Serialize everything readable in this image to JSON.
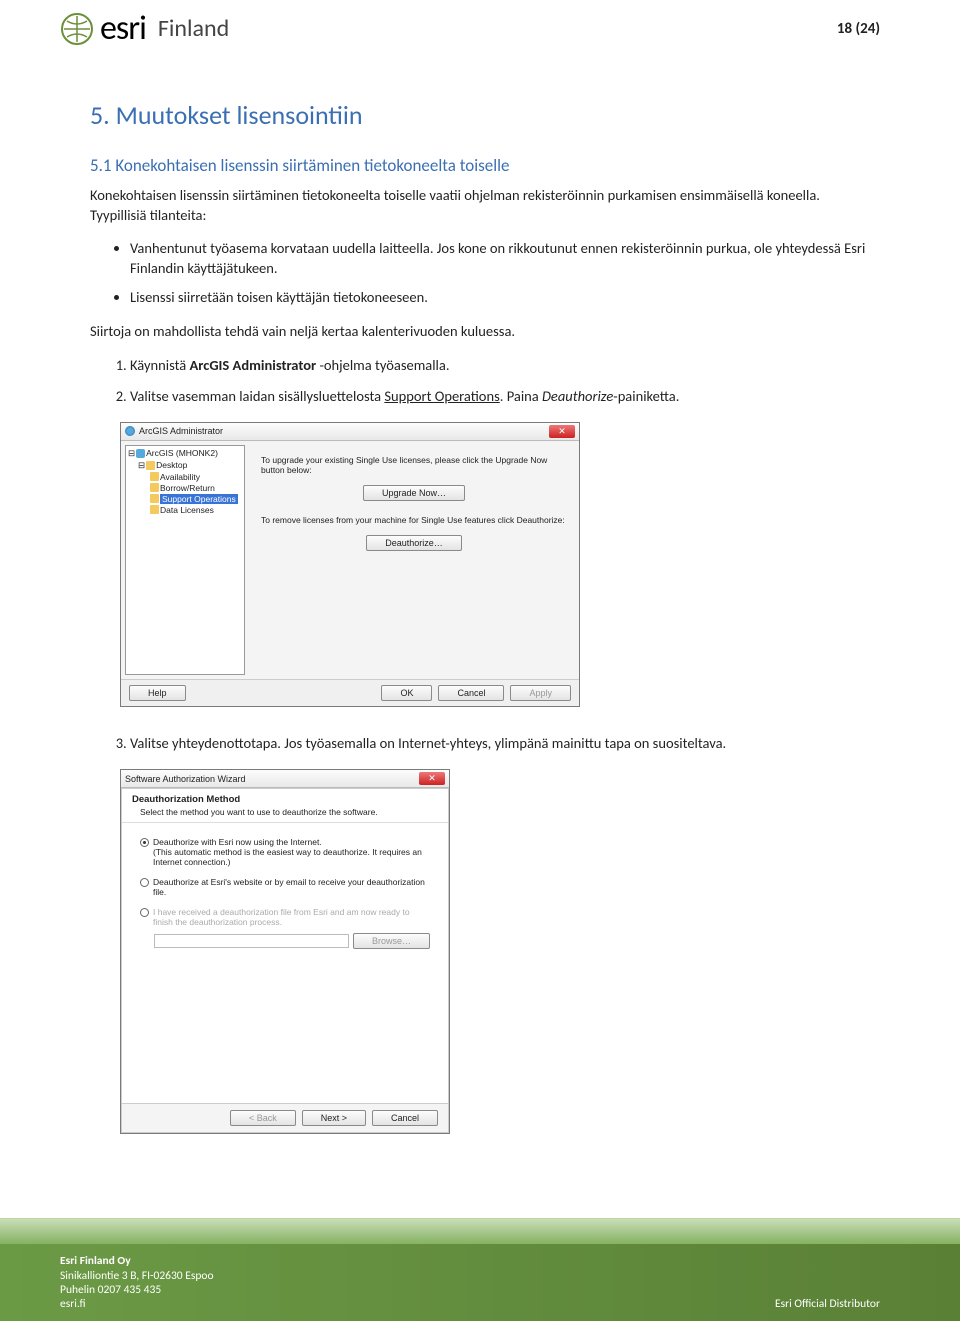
{
  "header": {
    "brand": "esri",
    "country": "Finland",
    "pagenum": "18 (24)"
  },
  "h1": "5. Muutokset lisensointiin",
  "h2": "5.1 Konekohtaisen lisenssin siirtäminen tietokoneelta toiselle",
  "intro": "Konekohtaisen lisenssin siirtäminen tietokoneelta toiselle vaatii ohjelman rekisteröinnin purkamisen ensimmäisellä koneella. Tyypillisiä tilanteita:",
  "bullets": [
    "Vanhentunut työasema korvataan uudella laitteella. Jos kone on rikkoutunut ennen rekisteröinnin purkua, ole yhteydessä Esri Finlandin käyttäjätukeen.",
    "Lisenssi siirretään toisen käyttäjän tietokoneeseen."
  ],
  "para2": "Siirtoja on mahdollista tehdä vain neljä kertaa kalenterivuoden kuluessa.",
  "steps": {
    "s1_a": "Käynnistä ",
    "s1_b": "ArcGIS Administrator",
    "s1_c": " -ohjelma työasemalla.",
    "s2_a": "Valitse vasemman laidan sisällysluettelosta ",
    "s2_b": "Support Operations",
    "s2_c": ". Paina ",
    "s2_d": "Deauthorize",
    "s2_e": "-painiketta.",
    "s3": "Valitse yhteydenottotapa. Jos työasemalla on Internet-yhteys, ylimpänä mainittu tapa on suositeltava."
  },
  "dlg1": {
    "title": "ArcGIS Administrator",
    "tree_root": "ArcGIS (MHONK2)",
    "tree_items": [
      "Desktop",
      "Availability",
      "Borrow/Return",
      "Support Operations",
      "Data Licenses"
    ],
    "txt1": "To upgrade your existing Single Use licenses, please click the Upgrade Now button below:",
    "btn_upgrade": "Upgrade Now…",
    "txt2": "To remove licenses from your machine for Single Use features click Deauthorize:",
    "btn_deauth": "Deauthorize…",
    "help": "Help",
    "ok": "OK",
    "cancel": "Cancel",
    "apply": "Apply"
  },
  "dlg2": {
    "title": "Software Authorization Wizard",
    "head": "Deauthorization Method",
    "sub": "Select the method you want to use to deauthorize the software.",
    "opt1": "Deauthorize with Esri now using the Internet.",
    "opt1b": "(This automatic method is the easiest way to deauthorize. It requires an Internet connection.)",
    "opt2": "Deauthorize at Esri's website or by email to receive your deauthorization file.",
    "opt3": "I have received a deauthorization file from Esri and am now ready to finish the deauthorization process.",
    "browse": "Browse…",
    "back": "< Back",
    "next": "Next >",
    "cancel": "Cancel"
  },
  "footer": {
    "company": "Esri Finland Oy",
    "addr": "Sinikalliontie 3 B, FI-02630 Espoo",
    "phone": "Puhelin 0207 435 435",
    "web": "esri.fi",
    "dist": "Esri Official Distributor"
  }
}
